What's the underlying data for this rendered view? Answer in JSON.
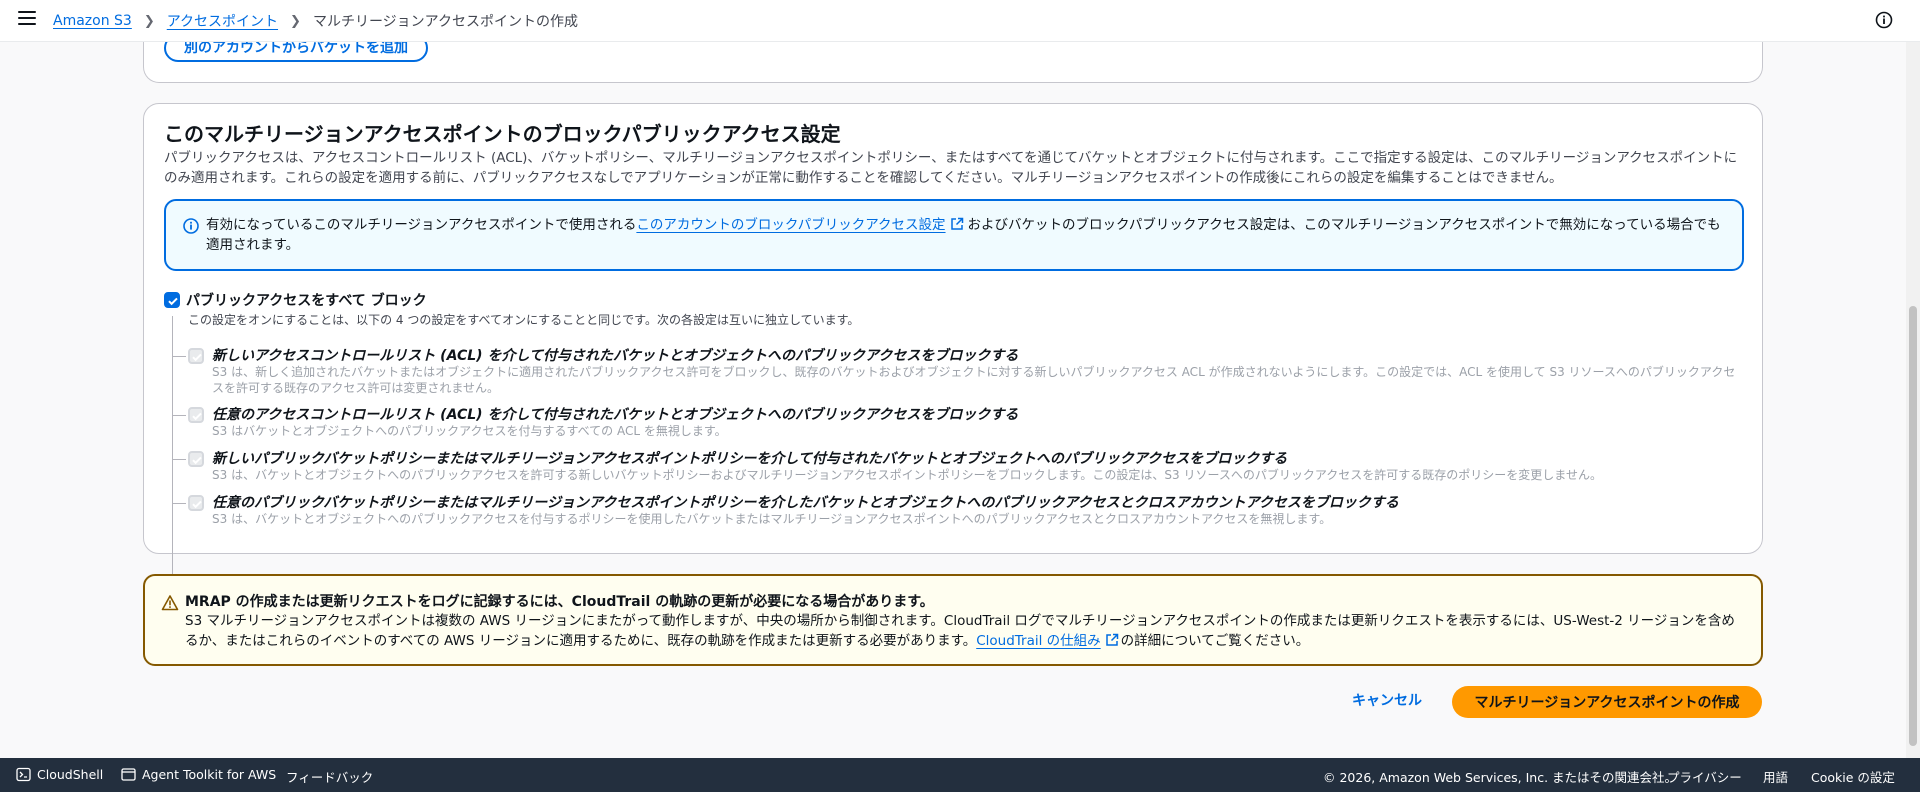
{
  "header": {
    "breadcrumb": [
      "Amazon S3",
      "アクセスポイント",
      "マルチリージョンアクセスポイントの作成"
    ]
  },
  "previous_section": {
    "button_label": "別のアカウントからバケットを追加"
  },
  "block_public_access": {
    "title": "このマルチリージョンアクセスポイントのブロックパブリックアクセス設定",
    "description": "パブリックアクセスは、アクセスコントロールリスト (ACL)、バケットポリシー、マルチリージョンアクセスポイントポリシー、またはすべてを通じてバケットとオブジェクトに付与されます。ここで指定する設定は、このマルチリージョンアクセスポイントにのみ適用されます。これらの設定を適用する前に、パブリックアクセスなしでアプリケーションが正常に動作することを確認してください。マルチリージョンアクセスポイントの作成後にこれらの設定を編集することはできません。",
    "info_alert": {
      "text_before": "有効になっているこのマルチリージョンアクセスポイントで使用される",
      "link": "このアカウントのブロックパブリックアクセス設定",
      "text_after": "およびバケットのブロックパブリックアクセス設定は、このマルチリージョンアクセスポイントで無効になっている場合でも適用されます。"
    },
    "main_option": {
      "label": "パブリックアクセスをすべて ブロック",
      "description": "この設定をオンにすることは、以下の 4 つの設定をすべてオンにすることと同じです。次の各設定は互いに独立しています。",
      "checked": true
    },
    "sub_options": [
      {
        "label": "新しいアクセスコントロールリスト (ACL) を介して付与されたバケットとオブジェクトへのパブリックアクセスをブロックする",
        "description": "S3 は、新しく追加されたバケットまたはオブジェクトに適用されたパブリックアクセス許可をブロックし、既存のバケットおよびオブジェクトに対する新しいパブリックアクセス ACL が作成されないようにします。この設定では、ACL を使用して S3 リソースへのパブリックアクセスを許可する既存のアクセス許可は変更されません。"
      },
      {
        "label": "任意のアクセスコントロールリスト (ACL) を介して付与されたバケットとオブジェクトへのパブリックアクセスをブロックする",
        "description": "S3 はバケットとオブジェクトへのパブリックアクセスを付与するすべての ACL を無視します。"
      },
      {
        "label": "新しいパブリックバケットポリシーまたはマルチリージョンアクセスポイントポリシーを介して付与されたバケットとオブジェクトへのパブリックアクセスをブロックする",
        "description": "S3 は、バケットとオブジェクトへのパブリックアクセスを許可する新しいバケットポリシーおよびマルチリージョンアクセスポイントポリシーをブロックします。この設定は、S3 リソースへのパブリックアクセスを許可する既存のポリシーを変更しません。"
      },
      {
        "label": "任意のパブリックバケットポリシーまたはマルチリージョンアクセスポイントポリシーを介したバケットとオブジェクトへのパブリックアクセスとクロスアカウントアクセスをブロックする",
        "description": "S3 は、バケットとオブジェクトへのパブリックアクセスを付与するポリシーを使用したバケットまたはマルチリージョンアクセスポイントへのパブリックアクセスとクロスアカウントアクセスを無視します。"
      }
    ]
  },
  "warning_alert": {
    "title": "MRAP の作成または更新リクエストをログに記録するには、CloudTrail の軌跡の更新が必要になる場合があります。",
    "text_before": "S3 マルチリージョンアクセスポイントは複数の AWS リージョンにまたがって動作しますが、中央の場所から制御されます。CloudTrail ログでマルチリージョンアクセスポイントの作成または更新リクエストを表示するには、US-West-2 リージョンを含めるか、またはこれらのイベントのすべての AWS リージョンに適用するために、既存の軌跡を作成または更新する必要があります。",
    "link": "CloudTrail の仕組み",
    "text_after": "の詳細についてご覧ください。"
  },
  "actions": {
    "cancel": "キャンセル",
    "create": "マルチリージョンアクセスポイントの作成"
  },
  "footer": {
    "cloudshell": "CloudShell",
    "agent_toolkit": "Agent Toolkit for AWS",
    "feedback": "フィードバック",
    "copyright": "© 2026, Amazon Web Services, Inc. またはその関連会社。",
    "privacy": "プライバシー",
    "terms": "用語",
    "cookie": "Cookie の設定"
  },
  "colors": {
    "link": "#006ce0",
    "primary_button": "#ff9900",
    "footer_bg": "#232f3e",
    "warning_border": "#855900"
  }
}
